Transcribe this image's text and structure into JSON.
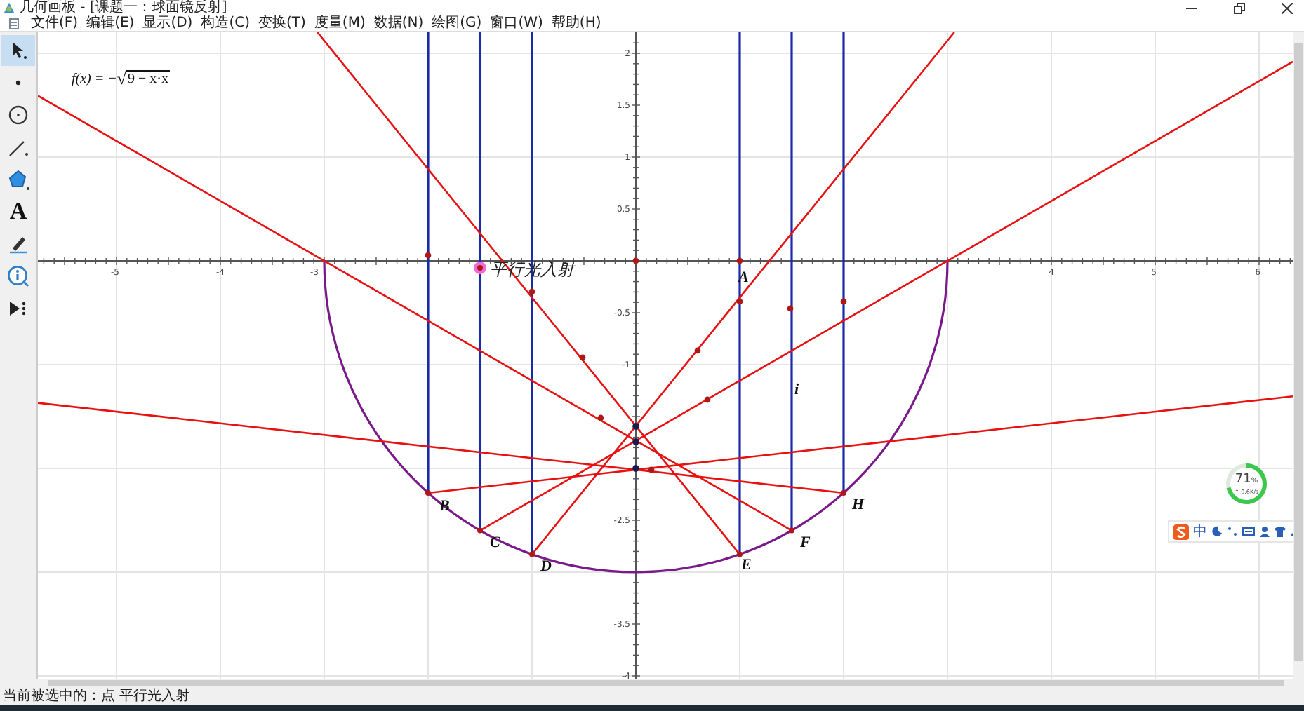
{
  "window": {
    "title": "几何画板 - [课题一：球面镜反射]"
  },
  "menu": [
    "文件(F)",
    "编辑(E)",
    "显示(D)",
    "构造(C)",
    "变换(T)",
    "度量(M)",
    "数据(N)",
    "绘图(G)",
    "窗口(W)",
    "帮助(H)"
  ],
  "toolbar": [
    {
      "kind": "arrow",
      "selected": true
    },
    {
      "kind": "point",
      "selected": false
    },
    {
      "kind": "compass",
      "selected": false
    },
    {
      "kind": "line",
      "selected": false
    },
    {
      "kind": "polygon",
      "selected": false
    },
    {
      "kind": "text",
      "label": "A",
      "selected": false
    },
    {
      "kind": "marker",
      "selected": false
    },
    {
      "kind": "info",
      "selected": false
    },
    {
      "kind": "custom",
      "selected": false
    }
  ],
  "canvas": {
    "function_label": {
      "lhs": "f(x) = −",
      "radical": "√",
      "radicand": "9 − x·x"
    },
    "x_ticks": [
      "-5",
      "-4",
      "-3",
      "4",
      "5",
      "6"
    ],
    "y_ticks": [
      "2",
      "1.5",
      "1",
      "0.5",
      "-0.5",
      "-1",
      "-2.5",
      "-3.5",
      "-4"
    ],
    "point_labels": [
      "A",
      "B",
      "C",
      "D",
      "E",
      "F",
      "H",
      "i"
    ],
    "selected_point": "平行光入射"
  },
  "network_widget": {
    "level": 0.71,
    "percent": "71",
    "unit": "%",
    "speed": "↑ 0.6K/s"
  },
  "ime_bar": {
    "mode": "中"
  },
  "status_bar": "当前被选中的：点 平行光入射"
}
